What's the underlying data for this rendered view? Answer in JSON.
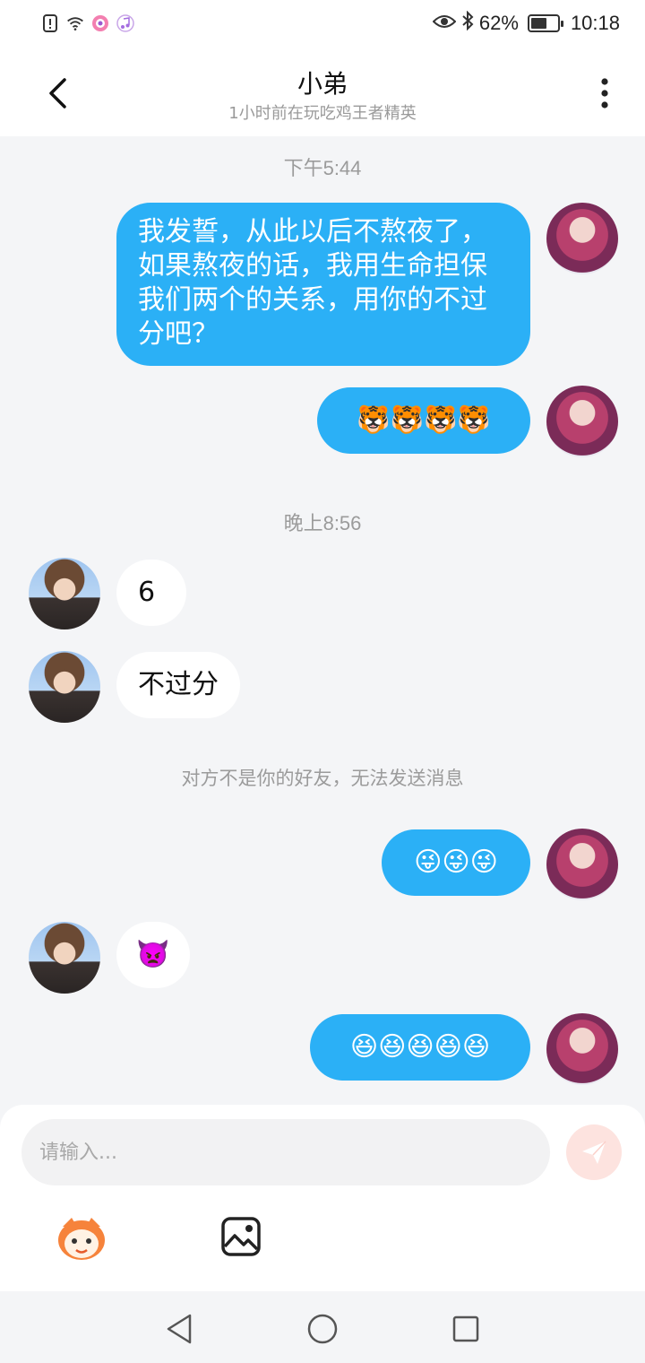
{
  "status_bar": {
    "battery": "62%",
    "battery_level": 0.62,
    "time": "10:18"
  },
  "header": {
    "title": "小弟",
    "subtitle": "1小时前在玩吃鸡王者精英"
  },
  "messages": {
    "time_1": "下午5:44",
    "m1": [
      "我发誓，从此以后不熬夜了，",
      "如果熬夜的话，我用生命担保",
      "我们两个的关系，用你的不过",
      "分吧？"
    ],
    "m2": "🐯🐯🐯🐯",
    "time_2": "晚上8:56",
    "m3": "6",
    "m4": "不过分",
    "system": "对方不是你的好友，无法发送消息",
    "m5": "😜😜😜",
    "m6": "👿",
    "m7": "😆😆😆😆😆"
  },
  "input": {
    "placeholder": "请输入..."
  },
  "colors": {
    "outgoing_bubble": "#2bb0f6",
    "incoming_bubble": "#ffffff",
    "background": "#f4f5f7",
    "send_button": "#fde3df"
  }
}
